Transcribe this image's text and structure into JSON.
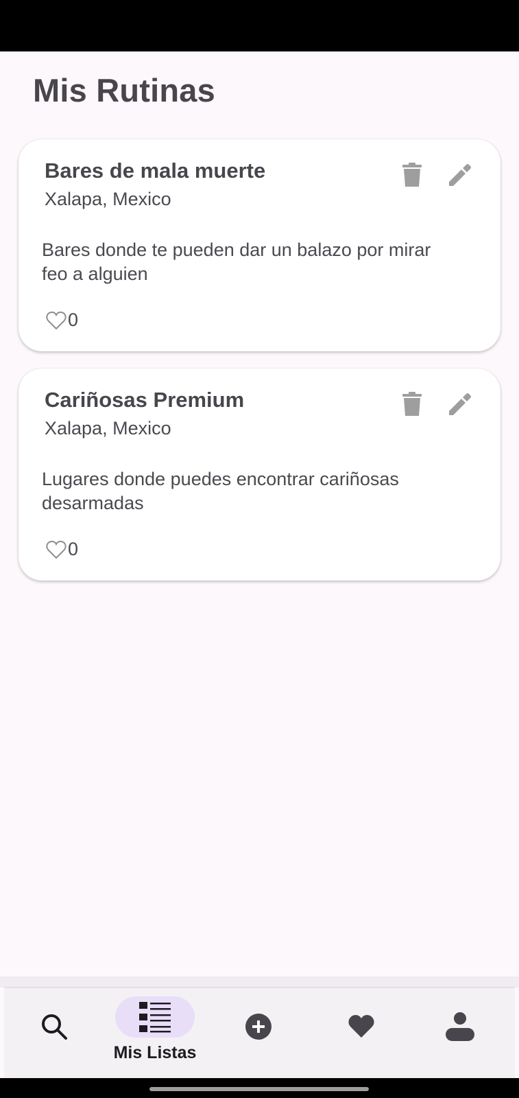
{
  "page": {
    "title": "Mis Rutinas"
  },
  "routines": [
    {
      "title": "Bares de mala muerte",
      "location": "Xalapa, Mexico",
      "description": "Bares donde te pueden dar un balazo por mirar feo a alguien",
      "likes": "0"
    },
    {
      "title": "Cariñosas Premium",
      "location": "Xalapa, Mexico",
      "description": "Lugares donde puedes encontrar cariñosas desarmadas",
      "likes": "0"
    }
  ],
  "card_icons": {
    "delete": "trash-icon",
    "edit": "pencil-icon",
    "like": "heart-outline-icon"
  },
  "bottom_nav": {
    "items": [
      {
        "icon": "search-icon",
        "label": ""
      },
      {
        "icon": "list-icon",
        "label": "Mis Listas",
        "active": true
      },
      {
        "icon": "add-circle-icon",
        "label": ""
      },
      {
        "icon": "heart-icon",
        "label": ""
      },
      {
        "icon": "person-icon",
        "label": ""
      }
    ]
  },
  "colors": {
    "background": "#fdf8fc",
    "card": "#ffffff",
    "text": "#48464c",
    "icon_muted": "#9e9e9e",
    "nav_active_indicator": "#e8def8",
    "nav_background": "#f4f1f5"
  }
}
